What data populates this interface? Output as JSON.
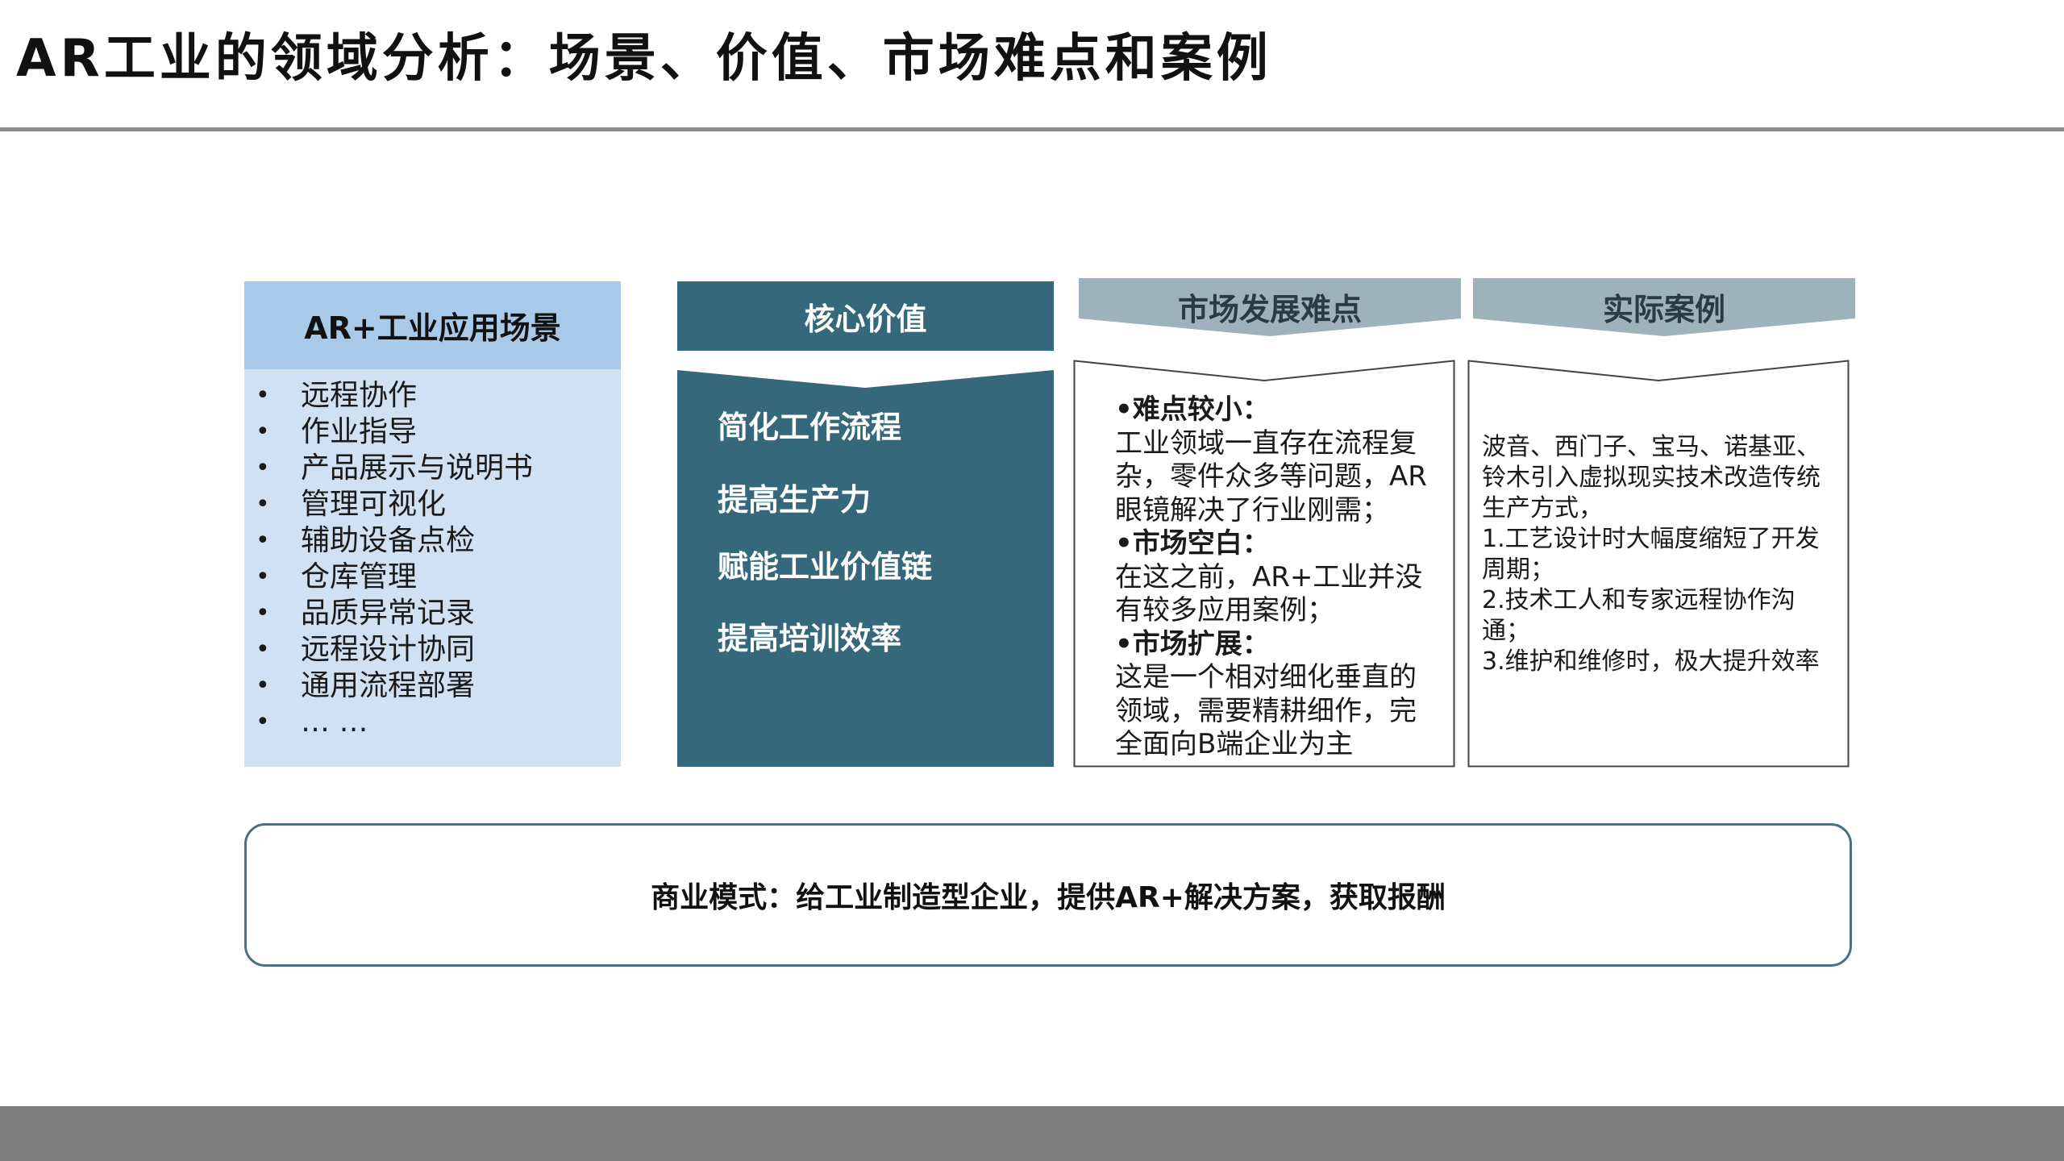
{
  "title": "AR工业的领域分析：场景、价值、市场难点和案例",
  "scenarios": {
    "header": "AR+工业应用场景",
    "bullet": "•",
    "items": [
      "远程协作",
      "作业指导",
      "产品展示与说明书",
      "管理可视化",
      "辅助设备点检",
      "仓库管理",
      "品质异常记录",
      "远程设计协同",
      "通用流程部署",
      "… …"
    ]
  },
  "core_value": {
    "header": "核心价值",
    "items": [
      "简化工作流程",
      "提高生产力",
      "赋能工业价值链",
      "提高培训效率"
    ]
  },
  "market": {
    "header": "市场发展难点",
    "sections": [
      {
        "heading": "•难点较小：",
        "body": "工业领域一直存在流程复杂，零件众多等问题，AR眼镜解决了行业刚需；"
      },
      {
        "heading": "•市场空白：",
        "body": "在这之前，AR+工业并没有较多应用案例；"
      },
      {
        "heading": "•市场扩展：",
        "body": "这是一个相对细化垂直的领域，需要精耕细作，完全面向B端企业为主"
      }
    ]
  },
  "cases": {
    "header": "实际案例",
    "lines": [
      "波音、西门子、宝马、诺基亚、铃木引入虚拟现实技术改造传统生产方式，",
      "1.工艺设计时大幅度缩短了开发周期；",
      "2.技术工人和专家远程协作沟通；",
      "3.维护和维修时，极大提升效率"
    ]
  },
  "business_model": "商业模式：给工业制造型企业，提供AR+解决方案，获取报酬",
  "colors": {
    "scenario_header": "#a9c9e8",
    "scenario_body": "#d0e1f3",
    "core_value": "#36687c",
    "chevron_header": "#9db2bb",
    "rule": "#8c8c8c",
    "footer": "#7f7f7f",
    "biz_border": "#4a6f87"
  }
}
